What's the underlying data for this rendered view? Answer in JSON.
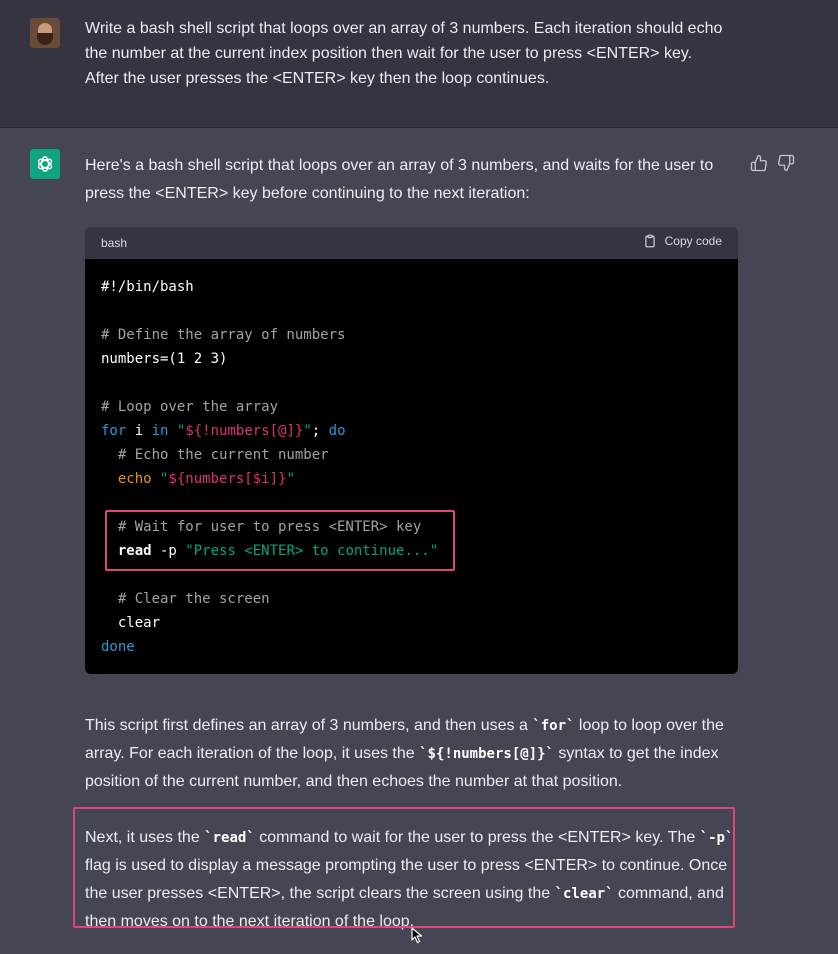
{
  "user_message": {
    "avatar": "user-avatar",
    "lines": [
      "Write a bash shell script that loops over an array of 3 numbers. Each iteration should echo",
      "the number at the current index position then wait for the user to press <ENTER> key.",
      "After the user presses the <ENTER> key then the loop continues."
    ]
  },
  "assistant_message": {
    "intro_lines": [
      "Here's a bash shell script that loops over an array of 3 numbers, and waits for the user to",
      "press the <ENTER> key before continuing to the next iteration:"
    ],
    "feedback": {
      "thumbs_up_icon": "thumbs-up-icon",
      "thumbs_down_icon": "thumbs-down-icon"
    },
    "code": {
      "language": "bash",
      "copy_label": "Copy code",
      "copy_icon": "clipboard-icon",
      "lines": [
        [
          {
            "t": "#!/bin/bash",
            "c": "plain"
          }
        ],
        [],
        [
          {
            "t": "# Define the array of numbers",
            "c": "comment"
          }
        ],
        [
          {
            "t": "numbers=(1 2 3)",
            "c": "plain"
          }
        ],
        [],
        [
          {
            "t": "# Loop over the array",
            "c": "comment"
          }
        ],
        [
          {
            "t": "for",
            "c": "kw"
          },
          {
            "t": " i ",
            "c": "plain"
          },
          {
            "t": "in",
            "c": "kw"
          },
          {
            "t": " ",
            "c": "plain"
          },
          {
            "t": "\"",
            "c": "str"
          },
          {
            "t": "${!numbers[@]}",
            "c": "var"
          },
          {
            "t": "\"",
            "c": "str"
          },
          {
            "t": "; ",
            "c": "plain"
          },
          {
            "t": "do",
            "c": "kw"
          }
        ],
        [
          {
            "t": "  # Echo the current number",
            "c": "comment"
          }
        ],
        [
          {
            "t": "  ",
            "c": "plain"
          },
          {
            "t": "echo",
            "c": "builtin"
          },
          {
            "t": " ",
            "c": "plain"
          },
          {
            "t": "\"",
            "c": "str"
          },
          {
            "t": "${numbers[$i]}",
            "c": "var"
          },
          {
            "t": "\"",
            "c": "str"
          }
        ],
        [],
        [
          {
            "t": "  # Wait for user to press <ENTER> key",
            "c": "comment"
          }
        ],
        [
          {
            "t": "  read",
            "c": "bold"
          },
          {
            "t": " -p ",
            "c": "plain"
          },
          {
            "t": "\"Press <ENTER> to continue...\"",
            "c": "str"
          }
        ],
        [],
        [
          {
            "t": "  # Clear the screen",
            "c": "comment"
          }
        ],
        [
          {
            "t": "  clear",
            "c": "plain"
          }
        ],
        [
          {
            "t": "done",
            "c": "kw"
          }
        ]
      ]
    },
    "paragraph1": [
      {
        "t": "This script first defines an array of 3 numbers, and then uses a "
      },
      {
        "t": "`for`",
        "code": true
      },
      {
        "t": " loop to loop over the array. For each iteration of the loop, it uses the "
      },
      {
        "t": "`${!numbers[@]}`",
        "code": true
      },
      {
        "t": " syntax to get the index position of the current number, and then echoes the number at that position."
      }
    ],
    "paragraph2": [
      {
        "t": "Next, it uses the "
      },
      {
        "t": "`read`",
        "code": true
      },
      {
        "t": " command to wait for the user to press the <ENTER> key. The "
      },
      {
        "t": "`-p`",
        "code": true
      },
      {
        "t": " flag is used to display a message prompting the user to press <ENTER> to continue. Once the user presses <ENTER>, the script clears the screen using the "
      },
      {
        "t": "`clear`",
        "code": true
      },
      {
        "t": " command, and then moves on to the next iteration of the loop."
      }
    ]
  },
  "colors": {
    "user_bg": "#343541",
    "assistant_bg": "#444654",
    "highlight": "#e0467c",
    "brand": "#10a37f"
  }
}
